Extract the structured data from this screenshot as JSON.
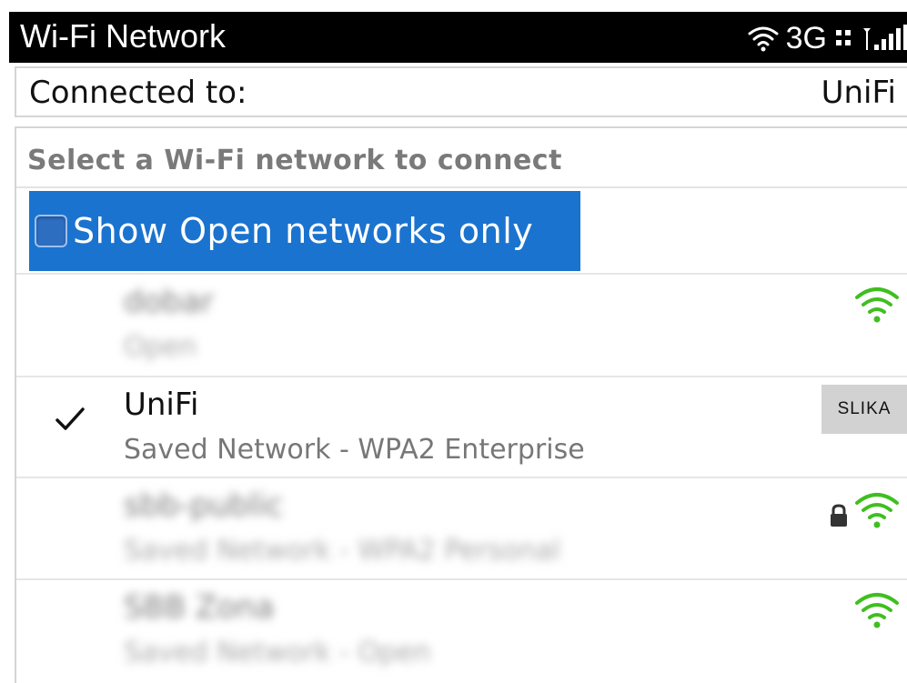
{
  "status_bar": {
    "title": "Wi-Fi Network",
    "network_type": "3G",
    "icons": [
      "wifi-icon",
      "data-arrows-icon",
      "signal-strength-icon"
    ]
  },
  "connection": {
    "label": "Connected to:",
    "value": "UniFi"
  },
  "network_list": {
    "heading": "Select a Wi-Fi network to connect",
    "filter_label": "Show Open networks only",
    "filter_checked": false,
    "networks": [
      {
        "name": "dobar",
        "subtitle": "Open",
        "icon": "wifi-icon",
        "blurred": true
      },
      {
        "name": "UniFi",
        "subtitle": "Saved Network - WPA2 Enterprise",
        "icon": "checkmark-icon",
        "badge": "SLIKA",
        "blurred": false
      },
      {
        "name": "sbb-public",
        "subtitle": "Saved Network - WPA2 Personal",
        "icon": "wifi-icon",
        "locked": true,
        "blurred": true
      },
      {
        "name": "SBB Zona",
        "subtitle": "Saved Network - Open",
        "icon": "wifi-icon",
        "blurred": true
      }
    ]
  },
  "colors": {
    "accent": "#1a73cf",
    "wifi_green": "#3fbf1f",
    "status_bar_bg": "#000000"
  }
}
